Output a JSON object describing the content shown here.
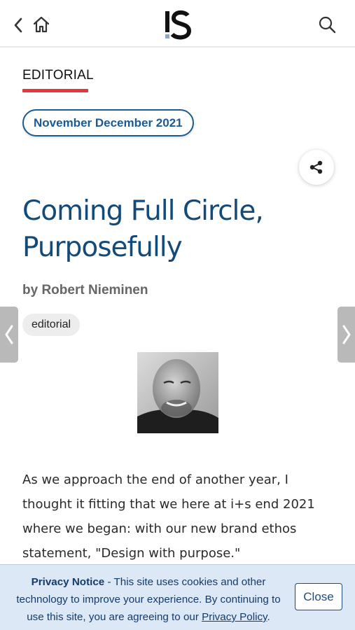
{
  "header": {
    "logo_text": "IS",
    "back_icon": "chevron-left-icon",
    "home_icon": "home-icon",
    "search_icon": "search-icon"
  },
  "article": {
    "section": "EDITORIAL",
    "issue": "November December 2021",
    "title_line1": "Coming Full Circle,",
    "title_line2": "Purposefully",
    "byline": "by Robert Nieminen",
    "tag": "editorial",
    "body_line1": "As we approach the end of another year, I",
    "body_line2": "thought it fitting that we here at i+s end 2021",
    "body_line3": "where we began: with our new brand ethos",
    "body_line4": "statement, \"Design with purpose.\""
  },
  "privacy": {
    "lead": "Privacy Notice",
    "text": " - This site uses cookies and other technology to improve your experience. By continuing to use this site, you are agreeing to our ",
    "link": "Privacy Policy",
    "end": ".",
    "close_label": "Close"
  },
  "colors": {
    "accent_red": "#e8343a",
    "title_blue": "#124a7a",
    "pill_blue": "#1b5a95",
    "banner_bg": "#dde8f6"
  }
}
